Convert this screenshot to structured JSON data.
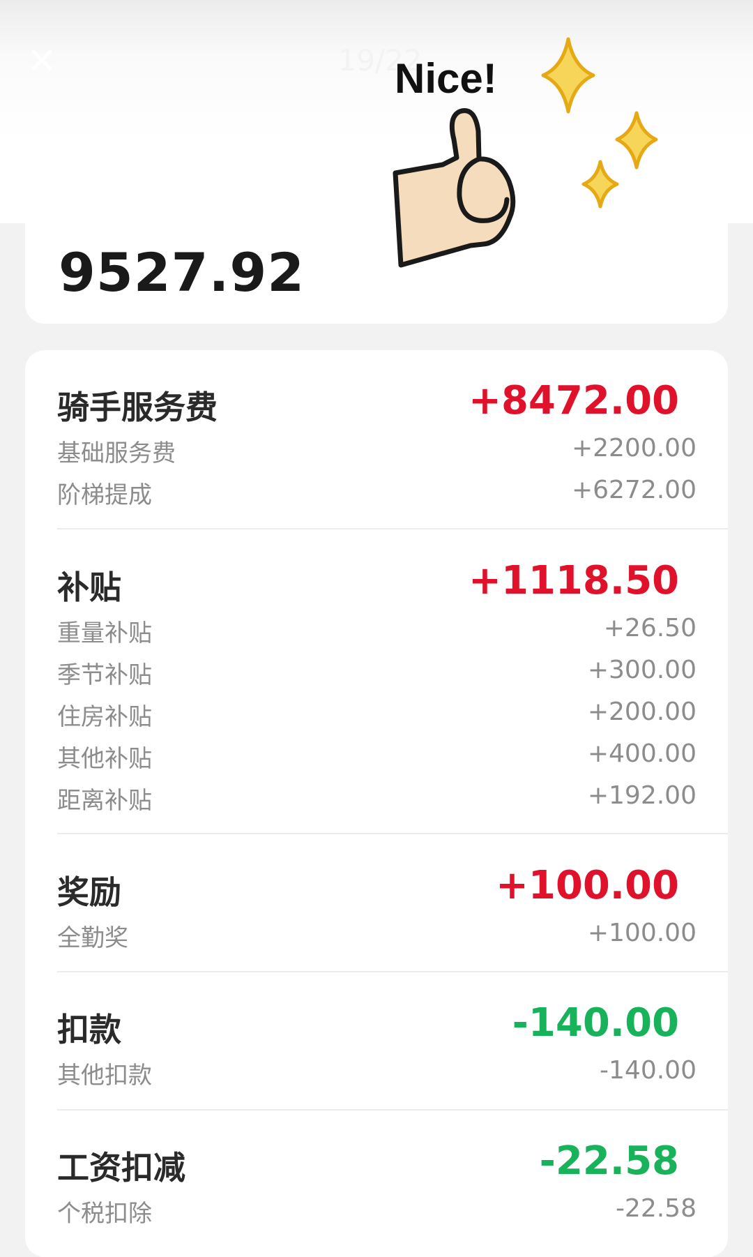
{
  "header": {
    "close_icon": "close-icon",
    "close_glyph": "✕",
    "page_counter": "19/22"
  },
  "summary": {
    "total": "9527.92"
  },
  "sticker": {
    "text": "Nice!",
    "icons": [
      "thumbs-up-icon",
      "sparkle-icon"
    ]
  },
  "colors": {
    "positive": "#e0122b",
    "negative": "#17b25a",
    "detail": "#8c8c8c"
  },
  "sections": [
    {
      "title": "骑手服务费",
      "total": "+8472.00",
      "items": [
        {
          "label": "基础服务费",
          "value": "+2200.00"
        },
        {
          "label": "阶梯提成",
          "value": "+6272.00"
        }
      ]
    },
    {
      "title": "补贴",
      "total": "+1118.50",
      "items": [
        {
          "label": "重量补贴",
          "value": "+26.50"
        },
        {
          "label": "季节补贴",
          "value": "+300.00"
        },
        {
          "label": "住房补贴",
          "value": "+200.00"
        },
        {
          "label": "其他补贴",
          "value": "+400.00"
        },
        {
          "label": "距离补贴",
          "value": "+192.00"
        }
      ]
    },
    {
      "title": "奖励",
      "total": "+100.00",
      "items": [
        {
          "label": "全勤奖",
          "value": "+100.00"
        }
      ]
    },
    {
      "title": "扣款",
      "total": "-140.00",
      "items": [
        {
          "label": "其他扣款",
          "value": "-140.00"
        }
      ]
    },
    {
      "title": "工资扣减",
      "total": "-22.58",
      "items": [
        {
          "label": "个税扣除",
          "value": "-22.58"
        }
      ]
    }
  ]
}
